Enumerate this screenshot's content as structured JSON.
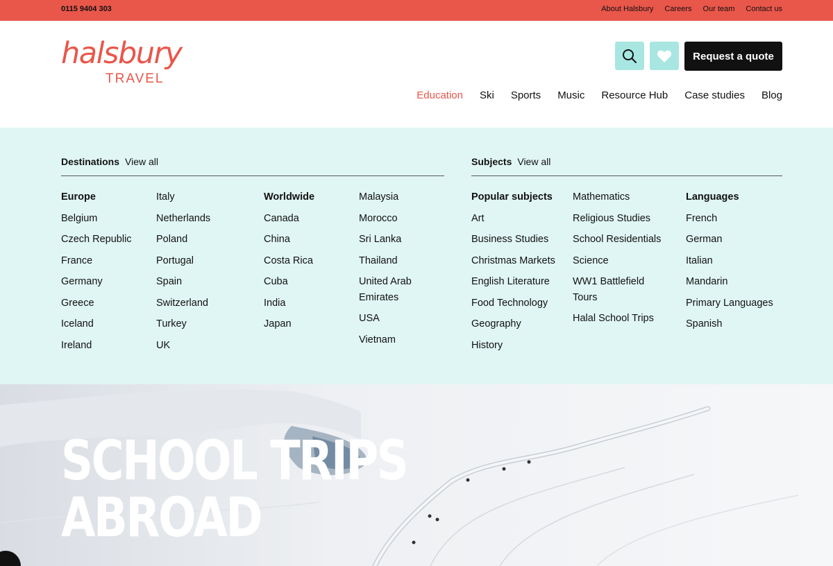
{
  "topbar": {
    "phone": "0115 9404 303",
    "links": [
      "About Halsbury",
      "Careers",
      "Our team",
      "Contact us"
    ]
  },
  "header": {
    "logo_word": "halsbury",
    "logo_sub": "TRAVEL",
    "search_icon": "search-icon",
    "heart_icon": "heart-icon",
    "quote_label": "Request a quote",
    "nav": [
      "Education",
      "Ski",
      "Sports",
      "Music",
      "Resource Hub",
      "Case studies",
      "Blog"
    ],
    "nav_active": "Education"
  },
  "mega": {
    "destinations": {
      "label": "Destinations",
      "view_all": "View all",
      "columns": [
        [
          "Europe",
          "Belgium",
          "Czech Republic",
          "France",
          "Germany",
          "Greece",
          "Iceland",
          "Ireland"
        ],
        [
          "Italy",
          "Netherlands",
          "Poland",
          "Portugal",
          "Spain",
          "Switzerland",
          "Turkey",
          "UK"
        ],
        [
          "Worldwide",
          "Canada",
          "China",
          "Costa Rica",
          "Cuba",
          "India",
          "Japan"
        ],
        [
          "Malaysia",
          "Morocco",
          "Sri Lanka",
          "Thailand",
          "United Arab Emirates",
          "USA",
          "Vietnam"
        ]
      ]
    },
    "subjects": {
      "label": "Subjects",
      "view_all": "View all",
      "columns": [
        [
          "Popular subjects",
          "Art",
          "Business Studies",
          "Christmas Markets",
          "English Literature",
          "Food Technology",
          "Geography",
          "History"
        ],
        [
          "Mathematics",
          "Religious Studies",
          "School Residentials",
          "Science",
          "WW1 Battlefield Tours",
          "Halal School Trips"
        ],
        [
          "Languages",
          "French",
          "German",
          "Italian",
          "Mandarin",
          "Primary Languages",
          "Spanish"
        ]
      ]
    }
  },
  "hero": {
    "title_line1": "SCHOOL TRIPS",
    "title_line2": "ABROAD"
  },
  "colors": {
    "accent": "#e9564a",
    "mint": "#a8e6e2",
    "menu_bg": "#e0f6f4"
  }
}
